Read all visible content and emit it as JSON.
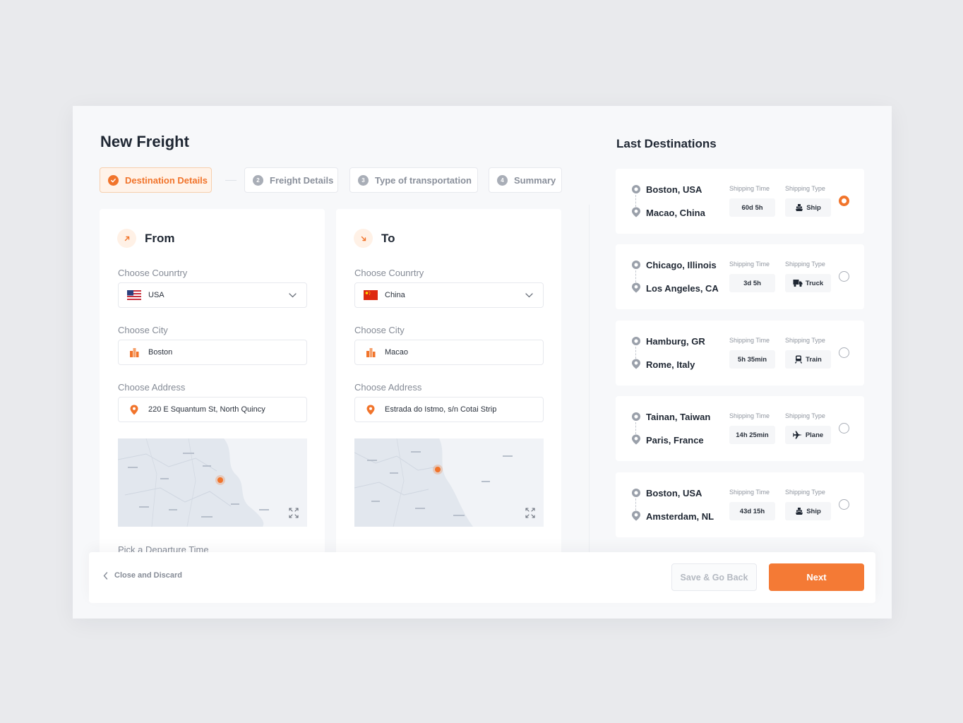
{
  "page": {
    "title": "New Freight"
  },
  "steps": [
    {
      "num": "",
      "label": "Destination Details",
      "state": "active"
    },
    {
      "num": "2",
      "label": "Freight Details",
      "state": "pending"
    },
    {
      "num": "3",
      "label": "Type of transportation",
      "state": "pending"
    },
    {
      "num": "4",
      "label": "Summary",
      "state": "pending"
    }
  ],
  "from": {
    "title": "From",
    "country_label": "Choose Counrtry",
    "country": "USA",
    "city_label": "Choose City",
    "city": "Boston",
    "address_label": "Choose Address",
    "address": "220 E Squantum St, North Quincy",
    "departure_label": "Pick a Departure Time"
  },
  "to": {
    "title": "To",
    "country_label": "Choose Counrtry",
    "country": "China",
    "city_label": "Choose City",
    "city": "Macao",
    "address_label": "Choose Address",
    "address": "Estrada do Istmo, s/n Cotai Strip"
  },
  "last_destinations": {
    "title": "Last Destinations",
    "time_label": "Shipping Time",
    "type_label": "Shipping Type",
    "items": [
      {
        "from": "Boston, USA",
        "to": "Macao, China",
        "time": "60d 5h",
        "type": "Ship",
        "icon": "ship-icon",
        "selected": true
      },
      {
        "from": "Chicago, Illinois",
        "to": "Los Angeles, CA",
        "time": "3d 5h",
        "type": "Truck",
        "icon": "truck-icon",
        "selected": false
      },
      {
        "from": "Hamburg, GR",
        "to": "Rome, Italy",
        "time": "5h 35min",
        "type": "Train",
        "icon": "train-icon",
        "selected": false
      },
      {
        "from": "Tainan, Taiwan",
        "to": "Paris, France",
        "time": "14h 25min",
        "type": "Plane",
        "icon": "plane-icon",
        "selected": false
      },
      {
        "from": "Boston, USA",
        "to": "Amsterdam, NL",
        "time": "43d 15h",
        "type": "Ship",
        "icon": "ship-icon",
        "selected": false
      }
    ]
  },
  "footer": {
    "close_label": "Close and Discard",
    "save_label": "Save & Go Back",
    "next_label": "Next"
  },
  "colors": {
    "accent": "#f1742b",
    "accent_soft": "#fff3e9",
    "background": "#f7f8fa"
  }
}
